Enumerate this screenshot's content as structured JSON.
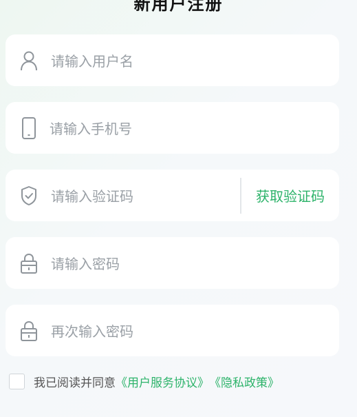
{
  "header": {
    "title": "新用户注册"
  },
  "form": {
    "username": {
      "placeholder": "请输入用户名",
      "icon": "user-icon"
    },
    "phone": {
      "placeholder": "请输入手机号",
      "icon": "phone-icon"
    },
    "code": {
      "placeholder": "请输入验证码",
      "icon": "shield-check-icon",
      "button": "获取验证码"
    },
    "password": {
      "placeholder": "请输入密码",
      "icon": "lock-icon"
    },
    "confirm": {
      "placeholder": "再次输入密码",
      "icon": "lock-icon"
    }
  },
  "agreement": {
    "checked": false,
    "text": "我已阅读并同意",
    "user_agreement": "《用户服务协议》",
    "privacy_policy": "《隐私政策》"
  },
  "colors": {
    "accent": "#2db36a",
    "placeholder": "#9aa0a6"
  }
}
